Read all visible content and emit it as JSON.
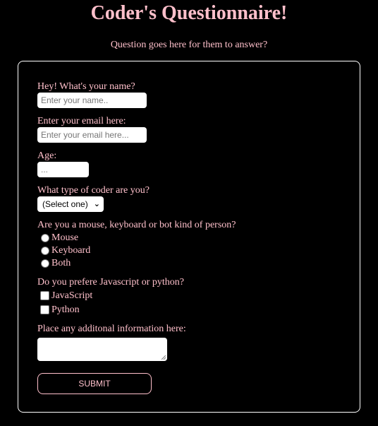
{
  "page": {
    "title": "Coder's Questionnaire!",
    "subtitle": "Question goes here for them to answer?"
  },
  "colors": {
    "background": "#000000",
    "accent_text": "#ffc0cb",
    "card_border": "#ffffff"
  },
  "form": {
    "name": {
      "label": "Hey! What's your name?",
      "placeholder": "Enter your name.."
    },
    "email": {
      "label": "Enter your email here:",
      "placeholder": "Enter your email here..."
    },
    "age": {
      "label": "Age:",
      "placeholder": "..."
    },
    "coder_type": {
      "label": "What type of coder are you?",
      "selected": "(Select one)",
      "icon": "chevron-down-icon"
    },
    "person_type": {
      "label": "Are you a mouse, keyboard or bot kind of person?",
      "options": [
        "Mouse",
        "Keyboard",
        "Both"
      ]
    },
    "language": {
      "label": "Do you prefere Javascript or python?",
      "options": [
        "JavaScript",
        "Python"
      ]
    },
    "additional": {
      "label": "Place any additonal information here:"
    },
    "submit_label": "SUBMIT"
  }
}
